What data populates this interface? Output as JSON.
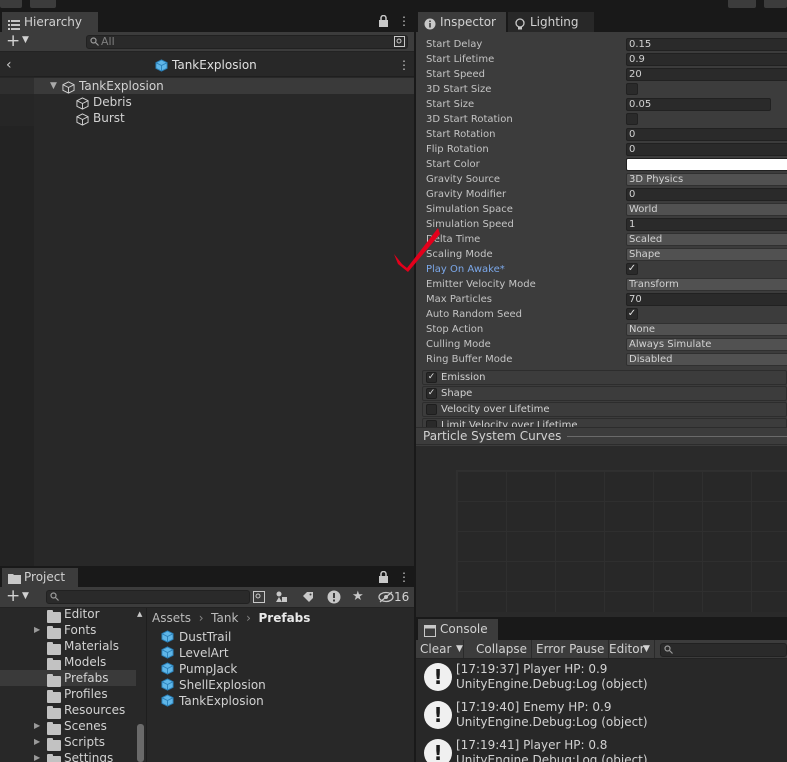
{
  "hierarchy": {
    "tab_label": "Hierarchy",
    "search_placeholder": "All",
    "scene_title": "TankExplosion",
    "items": [
      {
        "label": "TankExplosion"
      },
      {
        "label": "Debris"
      },
      {
        "label": "Burst"
      }
    ]
  },
  "inspector": {
    "tabs": [
      {
        "label": "Inspector"
      },
      {
        "label": "Lighting"
      }
    ],
    "properties": [
      {
        "label": "Start Delay",
        "value": "0.15",
        "kind": "field"
      },
      {
        "label": "Start Lifetime",
        "value": "0.9",
        "kind": "field"
      },
      {
        "label": "Start Speed",
        "value": "20",
        "kind": "field"
      },
      {
        "label": "3D Start Size",
        "value": "",
        "kind": "check"
      },
      {
        "label": "Start Size",
        "value": "0.05",
        "kind": "field"
      },
      {
        "label": "3D Start Rotation",
        "value": "",
        "kind": "check"
      },
      {
        "label": "Start Rotation",
        "value": "0",
        "kind": "field"
      },
      {
        "label": "Flip Rotation",
        "value": "0",
        "kind": "field"
      },
      {
        "label": "Start Color",
        "value": "",
        "kind": "color"
      },
      {
        "label": "Gravity Source",
        "value": "3D Physics",
        "kind": "dropdown"
      },
      {
        "label": "Gravity Modifier",
        "value": "0",
        "kind": "field"
      },
      {
        "label": "Simulation Space",
        "value": "World",
        "kind": "dropdown"
      },
      {
        "label": "Simulation Speed",
        "value": "1",
        "kind": "field"
      },
      {
        "label": "Delta Time",
        "value": "Scaled",
        "kind": "dropdown"
      },
      {
        "label": "Scaling Mode",
        "value": "Shape",
        "kind": "dropdown"
      },
      {
        "label": "Play On Awake*",
        "value": "✓",
        "kind": "check"
      },
      {
        "label": "Emitter Velocity Mode",
        "value": "Transform",
        "kind": "dropdown"
      },
      {
        "label": "Max Particles",
        "value": "70",
        "kind": "field"
      },
      {
        "label": "Auto Random Seed",
        "value": "✓",
        "kind": "check"
      },
      {
        "label": "Stop Action",
        "value": "None",
        "kind": "dropdown"
      },
      {
        "label": "Culling Mode",
        "value": "Always Simulate",
        "kind": "dropdown"
      },
      {
        "label": "Ring Buffer Mode",
        "value": "Disabled",
        "kind": "dropdown"
      }
    ],
    "modules": [
      {
        "label": "Emission",
        "check": "✓"
      },
      {
        "label": "Shape",
        "check": "✓"
      },
      {
        "label": "Velocity over Lifetime",
        "check": ""
      },
      {
        "label": "Limit Velocity over Lifetime",
        "check": ""
      }
    ],
    "curves_title": "Particle System Curves",
    "highlight_color": "#7ba7e8",
    "annotation_color": "#e3001b"
  },
  "project": {
    "tab_label": "Project",
    "hidden_count": "16",
    "folders": [
      {
        "label": "Editor",
        "arrow": ""
      },
      {
        "label": "Fonts",
        "arrow": "▶"
      },
      {
        "label": "Materials",
        "arrow": ""
      },
      {
        "label": "Models",
        "arrow": ""
      },
      {
        "label": "Prefabs",
        "arrow": ""
      },
      {
        "label": "Profiles",
        "arrow": ""
      },
      {
        "label": "Resources",
        "arrow": ""
      },
      {
        "label": "Scenes",
        "arrow": "▶"
      },
      {
        "label": "Scripts",
        "arrow": "▶"
      },
      {
        "label": "Settings",
        "arrow": "▶"
      }
    ],
    "breadcrumb": [
      "Assets",
      "Tank",
      "Prefabs"
    ],
    "assets": [
      {
        "label": "DustTrail"
      },
      {
        "label": "LevelArt"
      },
      {
        "label": "PumpJack"
      },
      {
        "label": "ShellExplosion"
      },
      {
        "label": "TankExplosion"
      }
    ]
  },
  "console": {
    "tab_label": "Console",
    "buttons": {
      "clear": "Clear",
      "collapse": "Collapse",
      "error_pause": "Error Pause",
      "editor": "Editor"
    },
    "entries": [
      {
        "line1": "[17:19:37] Player HP: 0.9",
        "line2": "UnityEngine.Debug:Log (object)"
      },
      {
        "line1": "[17:19:40] Enemy HP: 0.9",
        "line2": "UnityEngine.Debug:Log (object)"
      },
      {
        "line1": "[17:19:41] Player HP: 0.8",
        "line2": "UnityEngine.Debug:Log (object)"
      }
    ]
  }
}
